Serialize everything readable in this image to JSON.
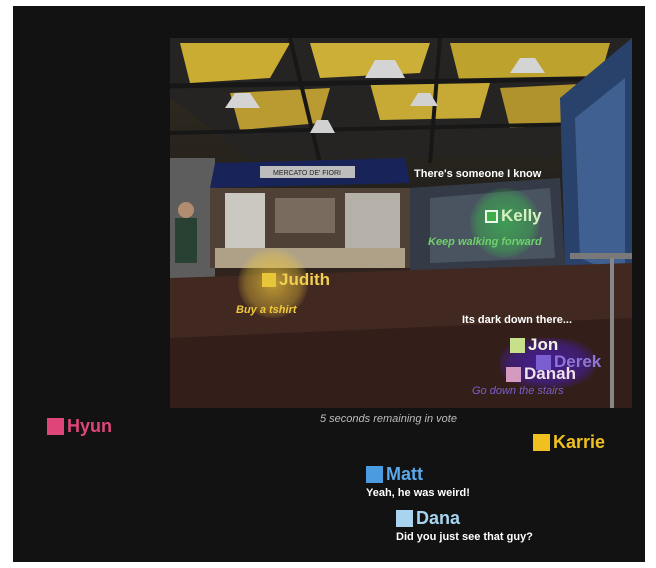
{
  "colors": {
    "background": "#121212",
    "kelly": "#3fae4a",
    "judith": "#e8c63a",
    "jon": "#c9e08a",
    "derek": "#7b5fd0",
    "danah": "#d49ac0",
    "hyun": "#e0457a",
    "karrie": "#f0c020",
    "matt": "#4a9be0",
    "dana": "#a8d4f0"
  },
  "scene": {
    "kiosk_sign": "MERCATO DE' FIORI"
  },
  "players_in_scene": [
    {
      "name": "Kelly"
    },
    {
      "name": "Judith"
    },
    {
      "name": "Jon"
    },
    {
      "name": "Derek"
    },
    {
      "name": "Danah"
    }
  ],
  "scene_messages": {
    "kelly_status": "There's someone I know",
    "kelly_vote": "Keep walking forward",
    "judith_vote": "Buy a tshirt",
    "jon_status": "Its dark down there...",
    "group_vote": "Go down the stairs"
  },
  "vote_timer": "5 seconds remaining in vote",
  "players_outside": [
    {
      "name": "Hyun"
    },
    {
      "name": "Karrie"
    },
    {
      "name": "Matt"
    },
    {
      "name": "Dana"
    }
  ],
  "chat": {
    "matt_message": "Yeah, he was weird!",
    "dana_message": "Did you just see that guy?"
  }
}
